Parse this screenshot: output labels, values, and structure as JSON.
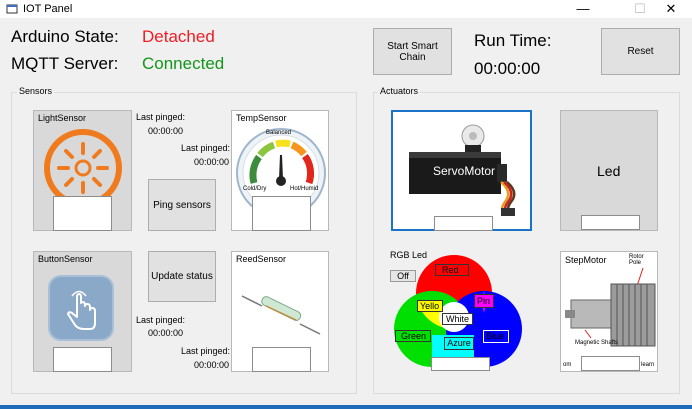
{
  "window": {
    "title": "IOT Panel",
    "min": "—",
    "max": "☐",
    "close": "✕"
  },
  "header": {
    "arduino_label": "Arduino State:",
    "arduino_value": "Detached",
    "mqtt_label": "MQTT Server:",
    "mqtt_value": "Connected",
    "start_button": "Start Smart Chain",
    "runtime_label": "Run Time:",
    "runtime_value": "00:00:00",
    "reset_button": "Reset"
  },
  "colors": {
    "detached": "#ee1c24",
    "connected": "#13961a",
    "selected_border": "#1a73c8",
    "sun": "#f07b1e"
  },
  "sensors": {
    "title": "Sensors",
    "light": {
      "label": "LightSensor",
      "last_pinged_label": "Last pinged:",
      "last_pinged": "00:00:00"
    },
    "temp": {
      "label": "TempSensor",
      "last_pinged_label": "Last pinged:",
      "last_pinged": "00:00:00",
      "gauge_top": "Balanced",
      "gauge_left": "Cold/Dry",
      "gauge_right": "Hot/Humid"
    },
    "ping_button": "Ping sensors",
    "update_button": "Update status",
    "button_sensor": {
      "label": "ButtonSensor",
      "last_pinged_label": "Last pinged:",
      "last_pinged": "00:00:00"
    },
    "reed": {
      "label": "ReedSensor",
      "last_pinged_label": "Last pinged:",
      "last_pinged": "00:00:00"
    }
  },
  "actuators": {
    "title": "Actuators",
    "servo": {
      "label": "ServoMotor"
    },
    "led": {
      "label": "Led"
    },
    "rgb": {
      "label": "RGB Led",
      "off": "Off",
      "red": "Red",
      "yellow": "Yello",
      "pink": "Pin",
      "white": "White",
      "green": "Green",
      "blue": "Blue",
      "azure": "Azure"
    },
    "step": {
      "label": "StepMotor",
      "annot_top": "Rotor Pole",
      "annot_shaft": "Magnetic Shafts",
      "annot_left": "om",
      "annot_right": "learn"
    }
  }
}
